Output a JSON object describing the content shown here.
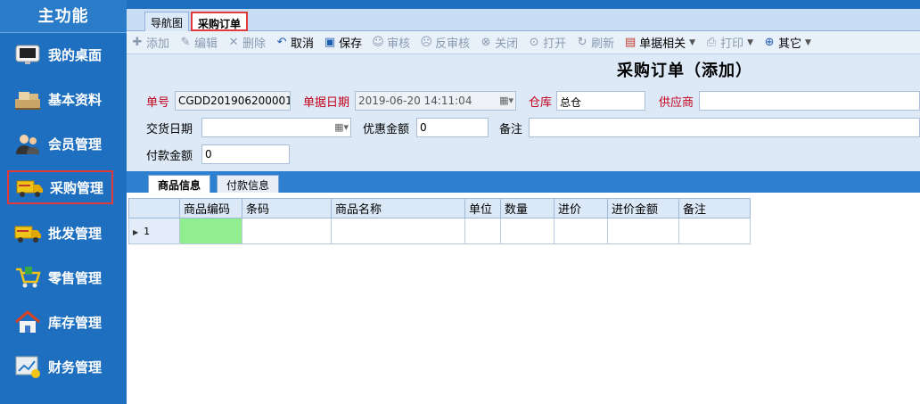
{
  "sidebar": {
    "title": "主功能",
    "items": [
      {
        "label": "我的桌面",
        "icon": "monitor-icon"
      },
      {
        "label": "基本资料",
        "icon": "boxes-icon"
      },
      {
        "label": "会员管理",
        "icon": "users-icon"
      },
      {
        "label": "采购管理",
        "icon": "truck-icon"
      },
      {
        "label": "批发管理",
        "icon": "truck-icon"
      },
      {
        "label": "零售管理",
        "icon": "cart-icon"
      },
      {
        "label": "库存管理",
        "icon": "house-icon"
      },
      {
        "label": "财务管理",
        "icon": "chart-icon"
      }
    ]
  },
  "tabs": [
    {
      "label": "导航图"
    },
    {
      "label": "采购订单",
      "active": true
    }
  ],
  "toolbar": {
    "add": "添加",
    "edit": "编辑",
    "delete": "删除",
    "cancel": "取消",
    "save": "保存",
    "audit": "审核",
    "unaudit": "反审核",
    "close": "关闭",
    "open": "打开",
    "refresh": "刷新",
    "related": "单据相关",
    "print": "打印",
    "other": "其它"
  },
  "form": {
    "title": "采购订单（添加）",
    "order_no_label": "单号",
    "order_no": "CGDD201906200001",
    "date_label": "单据日期",
    "date": "2019-06-20 14:11:04",
    "warehouse_label": "仓库",
    "warehouse": "总仓",
    "supplier_label": "供应商",
    "supplier": "",
    "delivery_label": "交货日期",
    "delivery": "",
    "discount_label": "优惠金额",
    "discount": "0",
    "remark_label": "备注",
    "remark": "",
    "paid_label": "付款金额",
    "paid": "0"
  },
  "subtabs": [
    {
      "label": "商品信息",
      "active": true
    },
    {
      "label": "付款信息"
    }
  ],
  "grid": {
    "columns": [
      "商品编码",
      "条码",
      "商品名称",
      "单位",
      "数量",
      "进价",
      "进价金额",
      "备注"
    ],
    "rows": [
      {
        "index": "1",
        "cells": [
          "",
          "",
          "",
          "",
          "",
          "",
          "",
          ""
        ]
      }
    ]
  },
  "colors": {
    "sidebar": "#1e6fbf",
    "required_label": "#c4001a",
    "highlight": "#e03a3a",
    "active_cell": "#90ee90"
  }
}
